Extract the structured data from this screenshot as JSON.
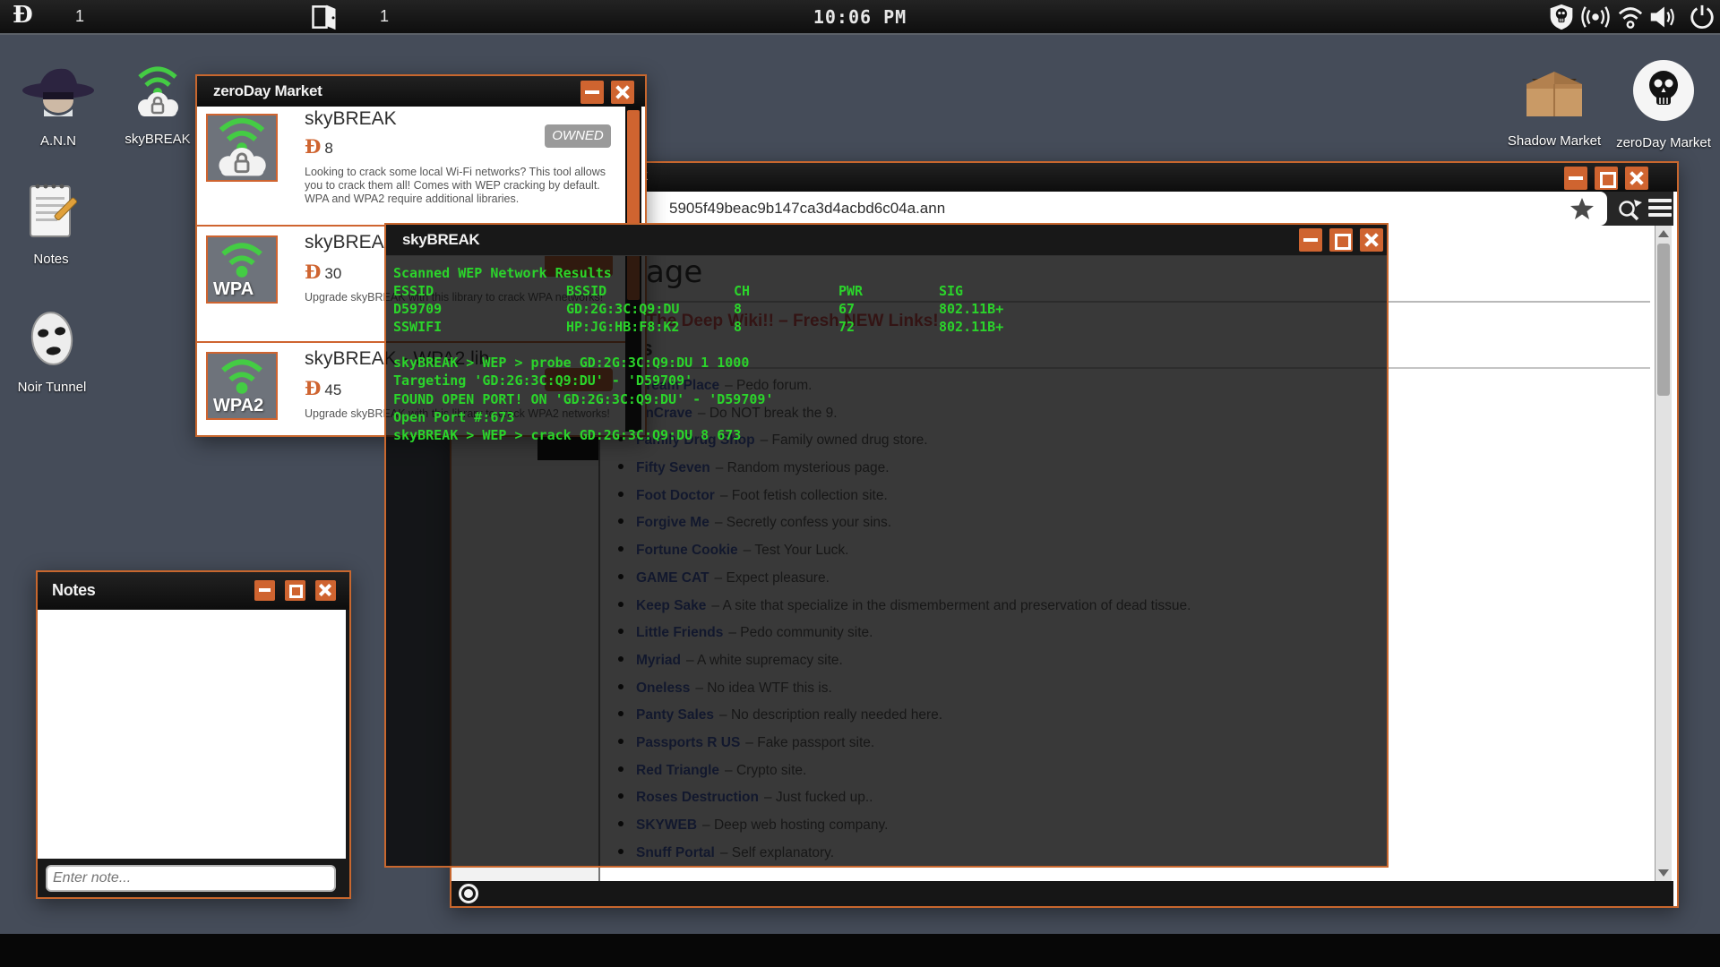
{
  "topbar": {
    "time": "10:06 PM",
    "currency_symbol": "Ð",
    "dosh_count": "1",
    "door_count": "1"
  },
  "desktop": {
    "icons_left": [
      {
        "label": "A.N.N"
      },
      {
        "label": "skyBREAK"
      },
      {
        "label": "Notes"
      },
      {
        "label": "Noir Tunnel"
      }
    ],
    "icons_right": [
      {
        "label": "Shadow Market"
      },
      {
        "label": "zeroDay Market"
      }
    ]
  },
  "market": {
    "title": "zeroDay Market",
    "currency": "Ð",
    "items": [
      {
        "name": "skyBREAK",
        "price": "8",
        "badge": "OWNED",
        "desc": "Looking to crack some local Wi-Fi networks? This tool allows you to crack them all! Comes with WEP cracking by default. WPA and WPA2 require additional libraries.",
        "icon_label": ""
      },
      {
        "name": "skyBREAK - WPA lib",
        "price": "30",
        "desc": "Upgrade skyBREAK with this library to crack WPA networks!",
        "icon_label": "WPA"
      },
      {
        "name": "skyBREAK - WPA2 lib",
        "price": "45",
        "desc": "Upgrade skyBREAK with this library to crack WPA2 networks!",
        "icon_label": "WPA2"
      }
    ]
  },
  "browser": {
    "title_visible": "k",
    "url": "5905f49beac9b147ca3d4acbd6c04a.ann",
    "page": {
      "heading": "Main Page",
      "banner": "Welcome to The Deep Wiki!! – Fresh NEW Links!",
      "section_heading": "Picks",
      "links": [
        {
          "name": "Dream Place",
          "desc": "– Pedo forum."
        },
        {
          "name": "EnCrave",
          "desc": "– Do NOT break the 9."
        },
        {
          "name": "Family Drug Shop",
          "desc": "– Family owned drug store."
        },
        {
          "name": "Fifty Seven",
          "desc": "– Random mysterious page."
        },
        {
          "name": "Foot Doctor",
          "desc": "– Foot fetish collection site."
        },
        {
          "name": "Forgive Me",
          "desc": "– Secretly confess your sins."
        },
        {
          "name": "Fortune Cookie",
          "desc": "– Test Your Luck."
        },
        {
          "name": "GAME CAT",
          "desc": "– Expect pleasure."
        },
        {
          "name": "Keep Sake",
          "desc": "– A site that specialize in the dismemberment and preservation of dead tissue."
        },
        {
          "name": "Little Friends",
          "desc": "– Pedo community site."
        },
        {
          "name": "Myriad",
          "desc": "– A white supremacy site."
        },
        {
          "name": "Oneless",
          "desc": "– No idea WTF this is."
        },
        {
          "name": "Panty Sales",
          "desc": "– No description really needed here."
        },
        {
          "name": "Passports R US",
          "desc": "– Fake passport site."
        },
        {
          "name": "Red Triangle",
          "desc": "– Crypto site."
        },
        {
          "name": "Roses Destruction",
          "desc": "– Just fucked up.."
        },
        {
          "name": "SKYWEB",
          "desc": "– Deep web hosting company."
        },
        {
          "name": "Snuff Portal",
          "desc": "– Self explanatory."
        }
      ]
    }
  },
  "terminal": {
    "title": "skyBREAK",
    "scan_header": "Scanned WEP Network Results",
    "columns": [
      "ESSID",
      "BSSID",
      "CH",
      "PWR",
      "SIG"
    ],
    "networks": [
      {
        "essid": "D59709",
        "bssid": "GD:2G:3C:Q9:DU",
        "ch": "8",
        "pwr": "67",
        "sig": "802.11B+"
      },
      {
        "essid": "SSWIFI",
        "bssid": "HP:JG:HB:F8:K2",
        "ch": "8",
        "pwr": "72",
        "sig": "802.11B+"
      }
    ],
    "commands": [
      "skyBREAK > WEP > probe GD:2G:3C:Q9:DU 1 1000",
      "Targeting 'GD:2G:3C:Q9:DU' - 'D59709'",
      "FOUND OPEN PORT! ON 'GD:2G:3C:Q9:DU' - 'D59709'",
      "Open Port #:673",
      "skyBREAK > WEP > crack GD:2G:3C:Q9:DU 8 673"
    ]
  },
  "notes": {
    "title": "Notes",
    "placeholder": "Enter note..."
  },
  "colors": {
    "accent_orange": "#c8672e",
    "terminal_green": "#2bd42b",
    "link_blue": "#3d5bc4",
    "banner_red": "#e04545",
    "desktop": "#454c59"
  }
}
